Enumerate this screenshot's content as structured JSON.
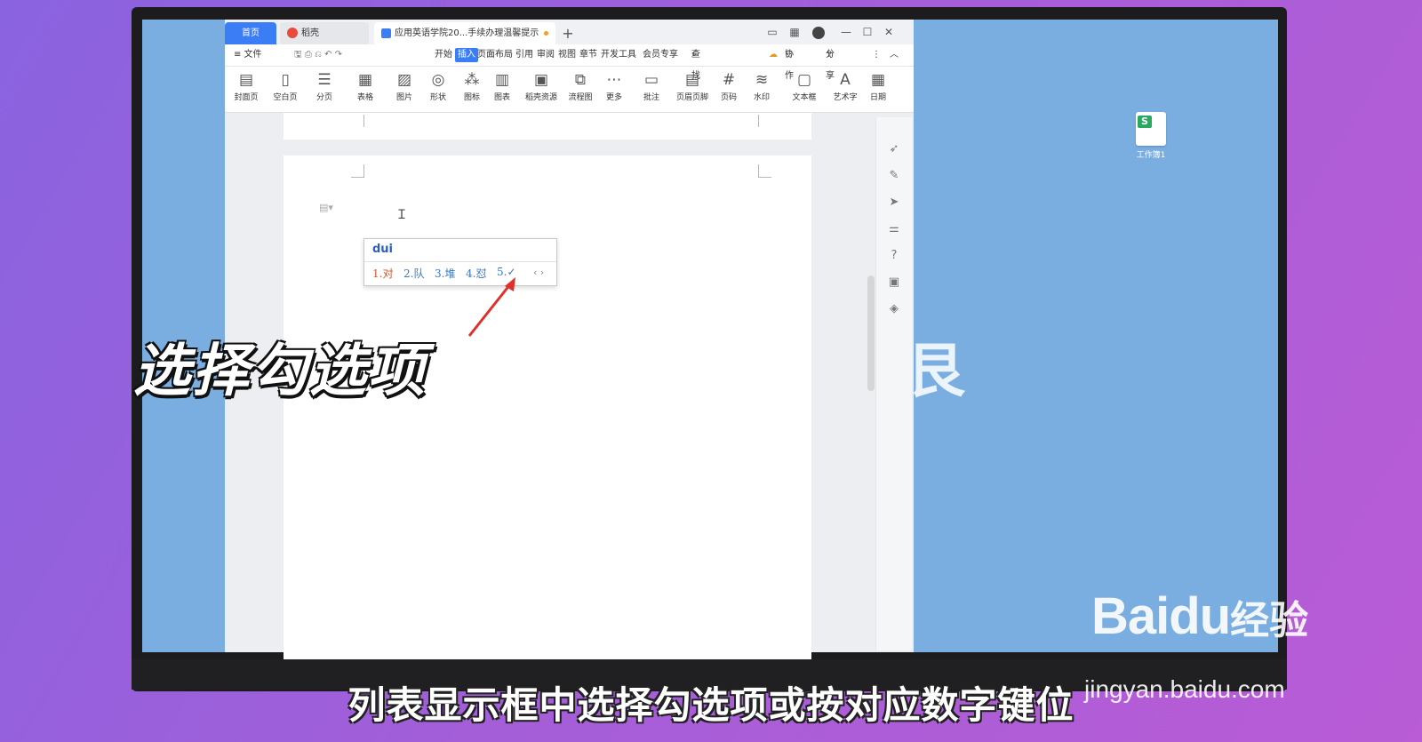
{
  "tabs": {
    "home": "首页",
    "draft": "稻壳",
    "doc": "应用英语学院20...手续办理温馨提示",
    "add": "+"
  },
  "window_controls": {
    "layout": "▭",
    "grid": "▦",
    "min": "—",
    "max": "☐",
    "close": "✕"
  },
  "menu": {
    "file": "≡ 文件",
    "items": [
      "开始",
      "插入",
      "页面布局",
      "引用",
      "审阅",
      "视图",
      "章节",
      "开发工具",
      "会员专享"
    ],
    "active_index": 1,
    "search": "查找",
    "collab": "协作",
    "share": "分享"
  },
  "ribbon": [
    {
      "label": "封面页",
      "icon": "cover-icon"
    },
    {
      "label": "空白页",
      "icon": "blank-page-icon"
    },
    {
      "label": "分页",
      "icon": "page-break-icon"
    },
    {
      "label": "表格",
      "icon": "table-icon"
    },
    {
      "label": "图片",
      "icon": "image-icon"
    },
    {
      "label": "形状",
      "icon": "shape-icon"
    },
    {
      "label": "图标",
      "icon": "icons-icon"
    },
    {
      "label": "图表",
      "icon": "chart-icon"
    },
    {
      "label": "稻壳资源",
      "icon": "resource-icon"
    },
    {
      "label": "流程图",
      "icon": "flowchart-icon"
    },
    {
      "label": "更多",
      "icon": "more-icon"
    },
    {
      "label": "批注",
      "icon": "comment-icon"
    },
    {
      "label": "页眉页脚",
      "icon": "header-footer-icon"
    },
    {
      "label": "页码",
      "icon": "page-number-icon"
    },
    {
      "label": "水印",
      "icon": "watermark-icon"
    },
    {
      "label": "文本框",
      "icon": "textbox-icon"
    },
    {
      "label": "艺术字",
      "icon": "wordart-icon"
    },
    {
      "label": "日期",
      "icon": "date-icon"
    }
  ],
  "ime": {
    "input": "dui",
    "candidates": [
      "1.对",
      "2.队",
      "3.堆",
      "4.怼",
      "5.✓"
    ],
    "nav": "‹ ›"
  },
  "desktop_icon_label": "工作簿1",
  "overlay": {
    "title": "选择勾选项",
    "subtitle": "列表显示框中选择勾选项或按对应数字键位"
  },
  "watermark": {
    "brand": "Bai",
    "brand_cn": "经验",
    "url": "jingyan.baidu.com"
  }
}
